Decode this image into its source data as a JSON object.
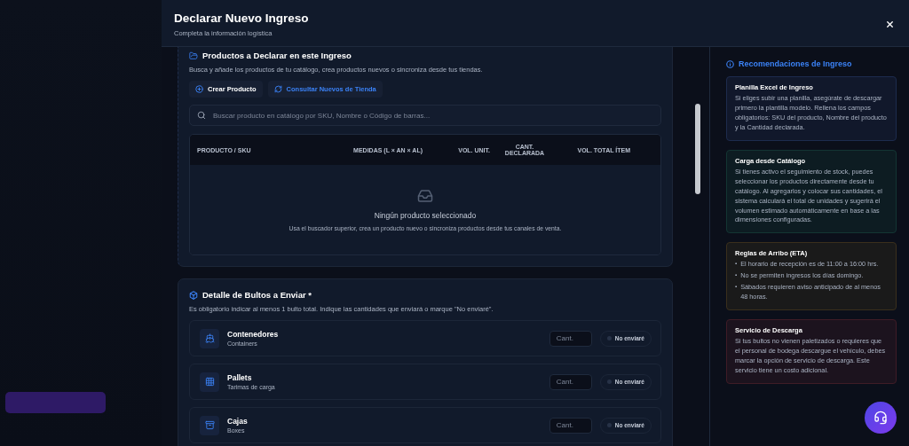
{
  "modal": {
    "title": "Declarar Nuevo Ingreso",
    "subtitle": "Completa la información logística"
  },
  "products": {
    "title": "Productos a Declarar en este Ingreso",
    "description": "Busca y añade los productos de tu catálogo, crea productos nuevos o sincroniza desde tus tiendas.",
    "buttons": [
      {
        "label": "Crear Producto",
        "kind": "create"
      },
      {
        "label": "Consultar Nuevos de Tienda",
        "kind": "sync"
      }
    ],
    "search": {
      "placeholder": "Buscar producto en catálogo por SKU, Nombre o Código de barras..."
    },
    "columns": [
      "PRODUCTO / SKU",
      "MEDIDAS (L × AN × AL)",
      "VOL. UNIT.",
      "CANT. DECLARADA",
      "VOL. TOTAL ÍTEM"
    ],
    "empty": {
      "title": "Ningún producto seleccionado",
      "text": "Usa el buscador superior, crea un producto nuevo o sincroniza productos desde tus canales de venta."
    }
  },
  "packages": {
    "title": "Detalle de Bultos a Enviar *",
    "description": "Es obligatorio indicar al menos 1 bulto total. Indique las cantidades que enviará o marque \"No enviaré\".",
    "rows": [
      {
        "kind": "ship",
        "name": "Contenedores",
        "subtitle": "Containers",
        "placeholder": "Cant.",
        "toggle": "No enviaré",
        "checked": false
      },
      {
        "kind": "grid",
        "name": "Pallets",
        "subtitle": "Tarimas de carga",
        "placeholder": "Cant.",
        "toggle": "No enviaré",
        "checked": false
      },
      {
        "kind": "box",
        "name": "Cajas",
        "subtitle": "Boxes",
        "placeholder": "Cant.",
        "toggle": "No enviaré",
        "checked": false
      }
    ]
  },
  "recommendations": {
    "title": "Recomendaciones de Ingreso",
    "notes": [
      {
        "kind": "text",
        "color": "#1d2b4d",
        "title": "Planilla Excel de Ingreso",
        "text": "Si eliges subir una planilla, asegúrate de descargar primero la plantilla modelo. Rellena los campos obligatorios: SKU del producto, Nombre del producto y la Cantidad declarada."
      },
      {
        "kind": "text",
        "color": "#133533",
        "title": "Carga desde Catálogo",
        "text": "Si tienes activo el seguimiento de stock, puedes seleccionar los productos directamente desde tu catálogo. Al agregarlos y colocar sus cantidades, el sistema calculará el total de unidades y sugerirá el volumen estimado automáticamente en base a las dimensiones configuradas."
      },
      {
        "kind": "list",
        "color": "#3a2f1c",
        "title": "Reglas de Arribo (ETA)",
        "items": [
          {
            "bullet": "▪",
            "text": "El horario de recepción es de 11:00 a 16:00 hrs."
          },
          {
            "bullet": "▪",
            "text": "No se permiten ingresos los días domingo."
          },
          {
            "bullet": "▪",
            "text": "Sábados requieren aviso anticipado de al menos 48 horas."
          }
        ]
      },
      {
        "kind": "text",
        "color": "#3f1c26",
        "title": "Servicio de Descarga",
        "text": "Si tus bultos no vienen paletizados o requieres que el personal de bodega descargue el vehículo, debes marcar la opción de servicio de descarga. Este servicio tiene un costo adicional."
      }
    ]
  }
}
